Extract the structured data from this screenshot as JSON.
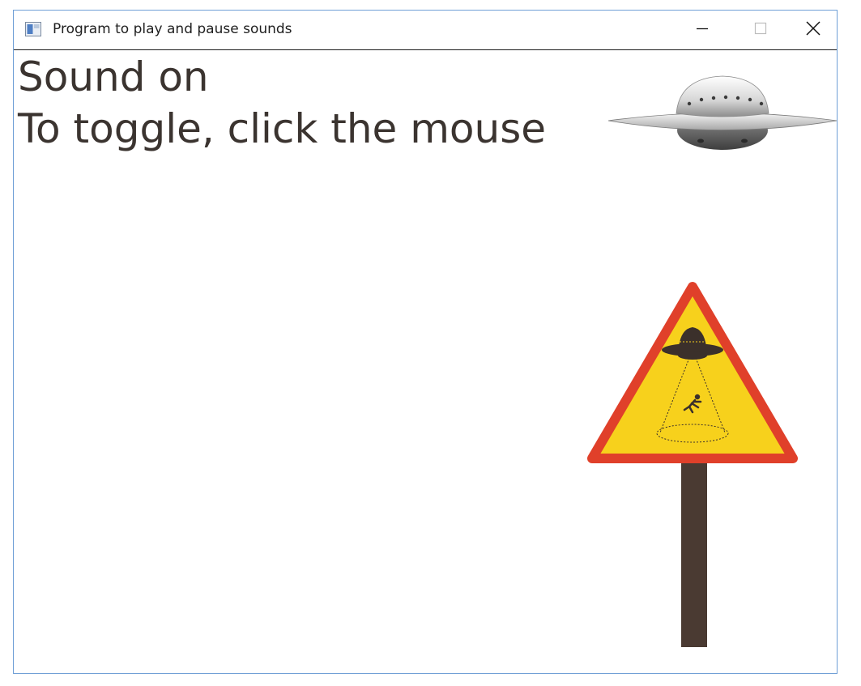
{
  "window": {
    "title": "Program to play and pause sounds",
    "controls": {
      "minimize_icon": "minimize-icon",
      "maximize_icon": "maximize-icon",
      "close_icon": "close-icon"
    }
  },
  "canvas": {
    "status_text": "Sound on",
    "instruction_text": "To toggle, click the mouse",
    "images": {
      "ufo": "flying-saucer-image",
      "sign": "ufo-warning-sign-image"
    },
    "colors": {
      "text": "#3b3430",
      "sign_border": "#e0402a",
      "sign_fill": "#f7d11c",
      "sign_post": "#4a3a32",
      "saucer": "#c8c8c8"
    }
  }
}
